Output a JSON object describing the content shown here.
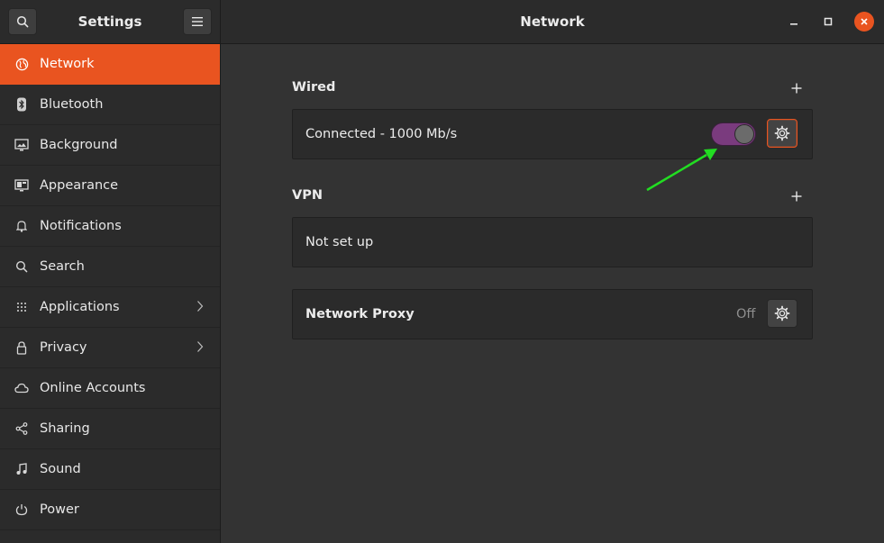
{
  "header": {
    "app_title": "Settings",
    "page_title": "Network"
  },
  "sidebar": {
    "items": [
      {
        "label": "Network",
        "icon": "network-icon"
      },
      {
        "label": "Bluetooth",
        "icon": "bluetooth-icon"
      },
      {
        "label": "Background",
        "icon": "background-icon"
      },
      {
        "label": "Appearance",
        "icon": "appearance-icon"
      },
      {
        "label": "Notifications",
        "icon": "bell-icon"
      },
      {
        "label": "Search",
        "icon": "search-icon"
      },
      {
        "label": "Applications",
        "icon": "grid-icon"
      },
      {
        "label": "Privacy",
        "icon": "lock-icon"
      },
      {
        "label": "Online Accounts",
        "icon": "cloud-icon"
      },
      {
        "label": "Sharing",
        "icon": "share-icon"
      },
      {
        "label": "Sound",
        "icon": "music-icon"
      },
      {
        "label": "Power",
        "icon": "power-icon"
      }
    ],
    "active": "Network"
  },
  "main": {
    "wired": {
      "title": "Wired",
      "status": "Connected - 1000 Mb/s",
      "toggle_on": true
    },
    "vpn": {
      "title": "VPN",
      "status": "Not set up"
    },
    "proxy": {
      "title": "Network Proxy",
      "status": "Off"
    }
  },
  "colors": {
    "accent": "#e95420",
    "toggle": "#7a3b7e",
    "annotation_arrow": "#22dd22"
  }
}
